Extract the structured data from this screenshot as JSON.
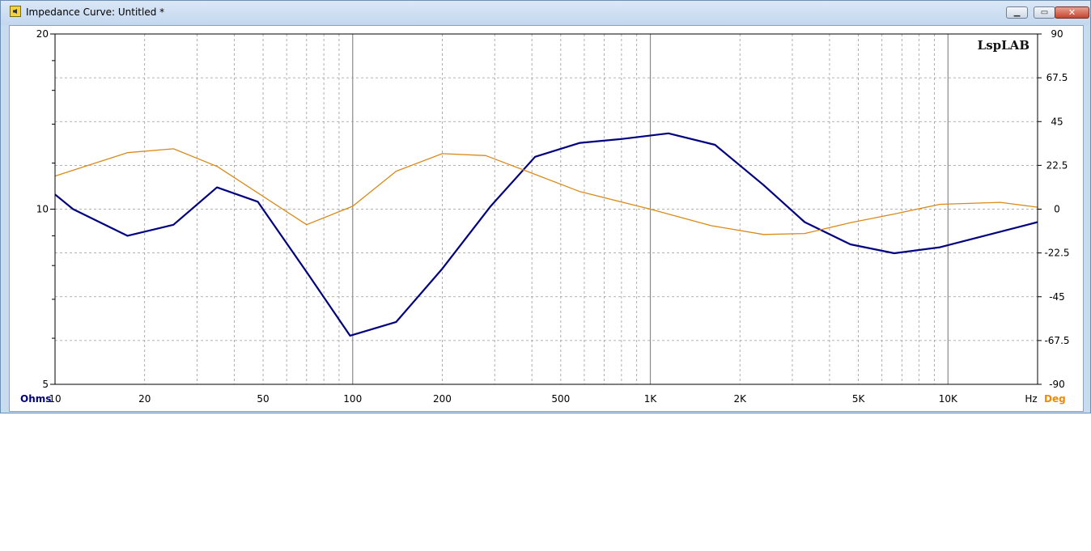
{
  "window": {
    "title": "Impedance Curve: Untitled *",
    "icon": "speaker-icon",
    "buttons": {
      "minimize": "minimize-icon",
      "maximize": "maximize-icon",
      "close": "close-icon"
    }
  },
  "chart_data": {
    "type": "line",
    "title": "",
    "logo": "LspLAB",
    "xlabel": "Hz",
    "ylabel_left": "Ohms",
    "ylabel_right": "Deg",
    "x_scale": "log",
    "xlim": [
      10,
      20000
    ],
    "ylim_left": [
      5,
      20
    ],
    "y_scale_left": "log",
    "ylim_right": [
      -90,
      90
    ],
    "x_ticks": [
      {
        "value": 10,
        "label": "10"
      },
      {
        "value": 20,
        "label": "20"
      },
      {
        "value": 50,
        "label": "50"
      },
      {
        "value": 100,
        "label": "100"
      },
      {
        "value": 200,
        "label": "200"
      },
      {
        "value": 500,
        "label": "500"
      },
      {
        "value": 1000,
        "label": "1K"
      },
      {
        "value": 2000,
        "label": "2K"
      },
      {
        "value": 5000,
        "label": "5K"
      },
      {
        "value": 10000,
        "label": "10K"
      }
    ],
    "y_left_ticks": [
      {
        "value": 5,
        "label": "5"
      },
      {
        "value": 10,
        "label": "10"
      },
      {
        "value": 20,
        "label": "20"
      }
    ],
    "y_right_ticks": [
      {
        "value": 90,
        "label": "90"
      },
      {
        "value": 67.5,
        "label": "67.5"
      },
      {
        "value": 45,
        "label": "45"
      },
      {
        "value": 22.5,
        "label": "22.5"
      },
      {
        "value": 0,
        "label": "0"
      },
      {
        "value": -22.5,
        "label": "-22.5"
      },
      {
        "value": -45,
        "label": "-45"
      },
      {
        "value": -67.5,
        "label": "-67.5"
      },
      {
        "value": -90,
        "label": "-90"
      }
    ],
    "grid": true,
    "colors": {
      "impedance": "#000080",
      "phase": "#d98a18",
      "axis_left": "#000080",
      "axis_right": "#f08c00"
    },
    "series": [
      {
        "axis": "left",
        "color": "#000080",
        "points": [
          [
            10,
            10.6
          ],
          [
            11.5,
            10.0
          ],
          [
            17.5,
            9.0
          ],
          [
            25,
            9.4
          ],
          [
            35,
            10.9
          ],
          [
            48,
            10.3
          ],
          [
            70,
            7.8
          ],
          [
            98,
            6.06
          ],
          [
            140,
            6.4
          ],
          [
            200,
            7.9
          ],
          [
            290,
            10.1
          ],
          [
            410,
            12.3
          ],
          [
            580,
            13.0
          ],
          [
            800,
            13.2
          ],
          [
            1150,
            13.5
          ],
          [
            1650,
            12.9
          ],
          [
            2400,
            11.0
          ],
          [
            3300,
            9.5
          ],
          [
            4700,
            8.7
          ],
          [
            6600,
            8.4
          ],
          [
            9400,
            8.6
          ],
          [
            20000,
            9.5
          ]
        ]
      },
      {
        "axis": "right",
        "color": "#d98a18",
        "points": [
          [
            10,
            17
          ],
          [
            17.5,
            29
          ],
          [
            25,
            31
          ],
          [
            35,
            22
          ],
          [
            70,
            -8
          ],
          [
            100,
            1.5
          ],
          [
            140,
            19.5
          ],
          [
            200,
            28.5
          ],
          [
            280,
            27.5
          ],
          [
            400,
            18.5
          ],
          [
            580,
            9
          ],
          [
            1000,
            0
          ],
          [
            1600,
            -8.5
          ],
          [
            2400,
            -13
          ],
          [
            3300,
            -12.5
          ],
          [
            4700,
            -7
          ],
          [
            6600,
            -2.5
          ],
          [
            9400,
            2.5
          ],
          [
            15000,
            3.5
          ],
          [
            20000,
            1
          ]
        ]
      }
    ]
  }
}
